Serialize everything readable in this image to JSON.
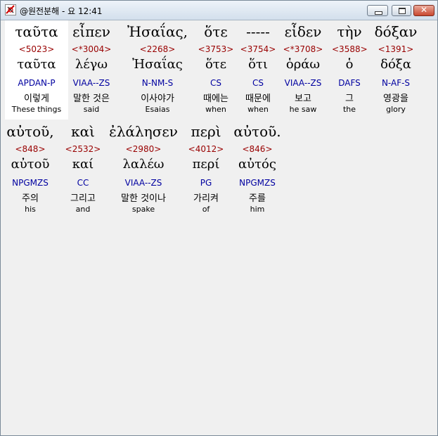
{
  "window": {
    "title": "@원전분해 - 요 12:41"
  },
  "words": [
    {
      "greek": "ταῦτα",
      "strong": "<5023>",
      "lemma": "ταῦτα",
      "morph": "APDAN-P",
      "korean": "이렇게",
      "english": "These things"
    },
    {
      "greek": "εἶπεν",
      "strong": "<*3004>",
      "lemma": "λέγω",
      "morph": "VIAA--ZS",
      "korean": "말한 것은",
      "english": "said"
    },
    {
      "greek": "Ἠσαΐας,",
      "strong": "<2268>",
      "lemma": "Ἠσαΐας",
      "morph": "N-NM-S",
      "korean": "이사야가",
      "english": "Esaias"
    },
    {
      "greek": "ὅτε",
      "strong": "<3753>",
      "lemma": "ὅτε",
      "morph": "CS",
      "korean": "때에는",
      "english": "when"
    },
    {
      "greek": "-----",
      "strong": "<3754>",
      "lemma": "ὅτι",
      "morph": "CS",
      "korean": "때문에",
      "english": "when"
    },
    {
      "greek": "εἶδεν",
      "strong": "<*3708>",
      "lemma": "ὁράω",
      "morph": "VIAA--ZS",
      "korean": "보고",
      "english": "he saw"
    },
    {
      "greek": "τὴν",
      "strong": "<3588>",
      "lemma": "ὁ",
      "morph": "DAFS",
      "korean": "그",
      "english": "the"
    },
    {
      "greek": "δόξαν",
      "strong": "<1391>",
      "lemma": "δόξα",
      "morph": "N-AF-S",
      "korean": "영광을",
      "english": "glory"
    },
    {
      "greek": "αὐτοῦ,",
      "strong": "<848>",
      "lemma": "αὐτοῦ",
      "morph": "NPGMZS",
      "korean": "주의",
      "english": "his"
    },
    {
      "greek": "καὶ",
      "strong": "<2532>",
      "lemma": "καί",
      "morph": "CC",
      "korean": "그리고",
      "english": "and"
    },
    {
      "greek": "ἐλάλησεν",
      "strong": "<2980>",
      "lemma": "λαλέω",
      "morph": "VIAA--ZS",
      "korean": "말한 것이나",
      "english": "spake"
    },
    {
      "greek": "περὶ",
      "strong": "<4012>",
      "lemma": "περί",
      "morph": "PG",
      "korean": "가리켜",
      "english": "of"
    },
    {
      "greek": "αὐτοῦ.",
      "strong": "<846>",
      "lemma": "αὐτός",
      "morph": "NPGMZS",
      "korean": "주를",
      "english": "him"
    }
  ]
}
